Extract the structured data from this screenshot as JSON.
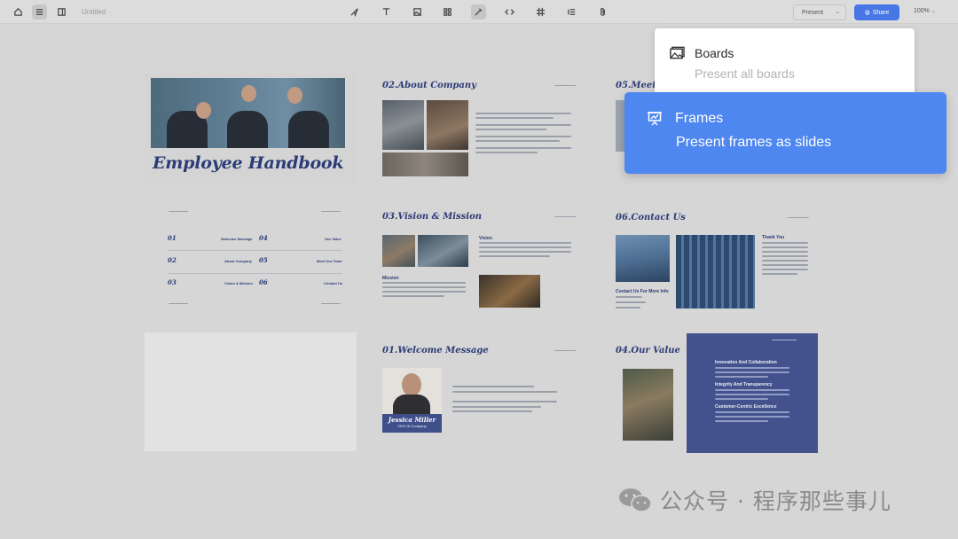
{
  "toolbar": {
    "doc_title": "Untitled",
    "present_label": "Present",
    "share_label": "Share",
    "zoom_label": "100%",
    "icons": [
      "home-icon",
      "menu-icon",
      "panel-icon",
      "pointer-icon",
      "text-icon",
      "image-icon",
      "components-icon",
      "pen-icon",
      "code-icon",
      "frame-icon",
      "list-icon",
      "attachment-icon"
    ]
  },
  "slides": {
    "cover_title": "Employee Handbook",
    "about_title": "02.About Company",
    "vision_title": "03.Vision & Mission",
    "vision_label": "Vision",
    "mission_label": "Mission",
    "welcome_title": "01.Welcome Message",
    "person_name": "Jessica Miller",
    "person_role": "CEO Of Company",
    "contact_title": "06.Contact Us",
    "contact_info": "Contact Us For More Info",
    "thank_you": "Thank You",
    "value_title": "04.Our Value",
    "values": [
      "Innovation And Collaboration",
      "Integrity And Transparency",
      "Customer-Centric Excellence"
    ],
    "partial_title": "05.Meet",
    "toc": [
      {
        "num": "01",
        "label": "Welcome Message"
      },
      {
        "num": "02",
        "label": "About Company"
      },
      {
        "num": "03",
        "label": "Vision & Mission"
      },
      {
        "num": "04",
        "label": "Our Value"
      },
      {
        "num": "05",
        "label": "Meet Our Team"
      },
      {
        "num": "06",
        "label": "Contact Us"
      }
    ]
  },
  "present_menu": {
    "boards_title": "Boards",
    "boards_desc": "Present all boards",
    "frames_title": "Frames",
    "frames_desc": "Present frames as slides"
  },
  "watermark": {
    "text": "公众号 · 程序那些事儿"
  },
  "colors": {
    "accent": "#4e87f0",
    "navy": "#2c3b76",
    "value_box": "#43528c"
  }
}
